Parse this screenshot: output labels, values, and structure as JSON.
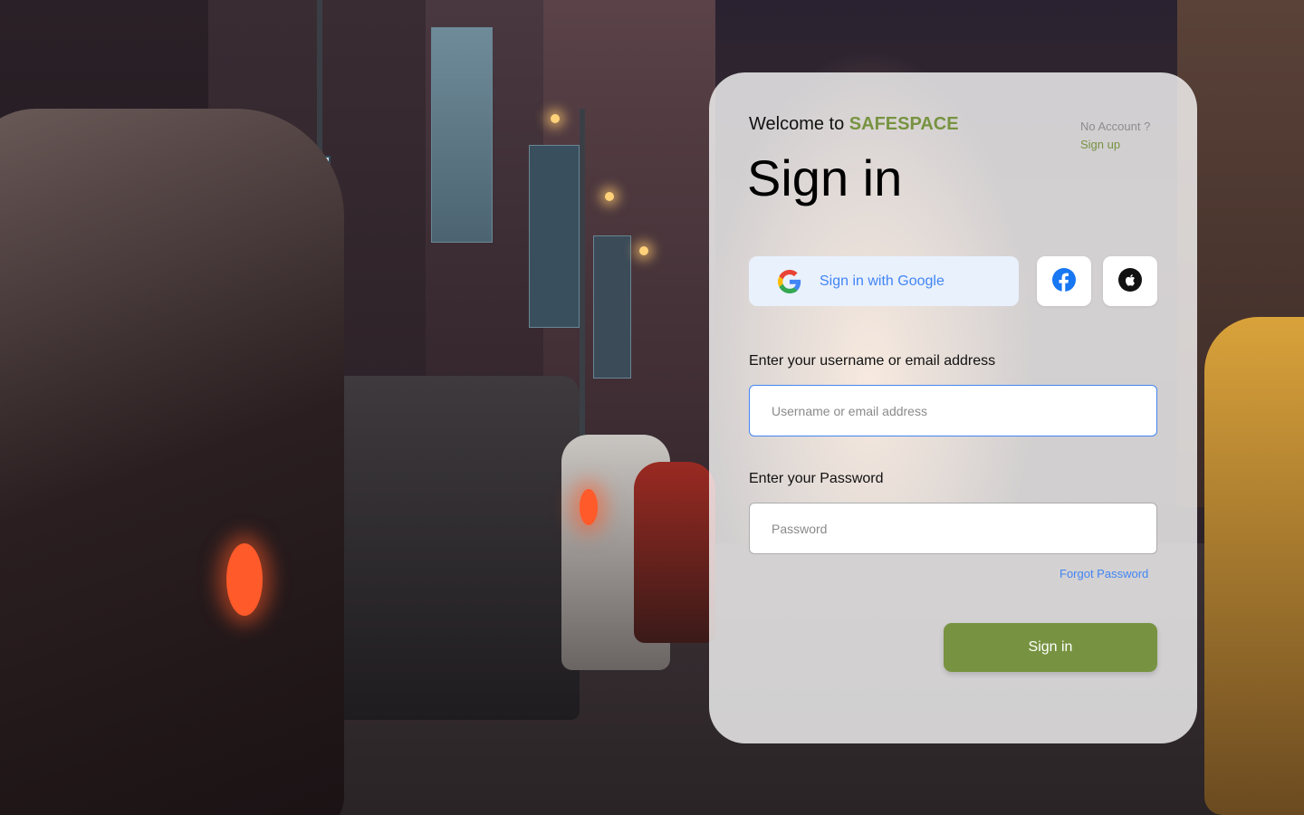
{
  "header": {
    "welcome_prefix": "Welcome to ",
    "brand_name": "SAFESPACE",
    "title": "Sign in",
    "no_account_text": "No Account ?",
    "signup_link": "Sign up"
  },
  "social": {
    "google_label": "Sign in with Google",
    "google_icon": "google-icon",
    "facebook_icon": "facebook-icon",
    "apple_icon": "apple-icon"
  },
  "form": {
    "username_label": "Enter your username or email address",
    "username_placeholder": "Username or email address",
    "username_value": "",
    "password_label": "Enter your Password",
    "password_placeholder": "Password",
    "password_value": "",
    "forgot_link": "Forgot Password",
    "submit_label": "Sign in"
  },
  "colors": {
    "brand": "#779341",
    "link_blue": "#4285f4",
    "google_button_bg": "#e9f1fd",
    "card_bg": "rgba(255,255,255,0.78)"
  }
}
